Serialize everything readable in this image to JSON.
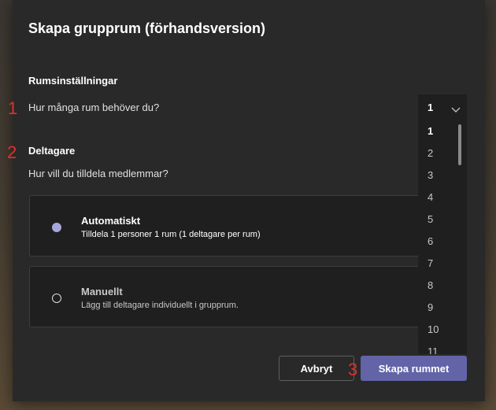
{
  "dialog": {
    "title": "Skapa grupprum (förhandsversion)",
    "room_settings_heading": "Rumsinställningar",
    "rooms_question": "Hur många rum behöver du?",
    "participants_heading": "Deltagare",
    "assign_question": "Hur vill du tilldela medlemmar?",
    "options": [
      {
        "title": "Automatiskt",
        "description": "Tilldela 1 personer 1 rum (1 deltagare per rum)",
        "selected": true
      },
      {
        "title": "Manuellt",
        "description": "Lägg till deltagare individuellt i grupprum.",
        "selected": false
      }
    ],
    "cancel_label": "Avbryt",
    "create_label": "Skapa rummet"
  },
  "room_select": {
    "value": "1",
    "options": [
      "1",
      "2",
      "3",
      "4",
      "5",
      "6",
      "7",
      "8",
      "9",
      "10",
      "11"
    ]
  },
  "markers": [
    "1",
    "2",
    "3"
  ],
  "colors": {
    "accent": "#6264a7",
    "marker": "#e0302c",
    "radio_selected": "#a6a7dc"
  }
}
